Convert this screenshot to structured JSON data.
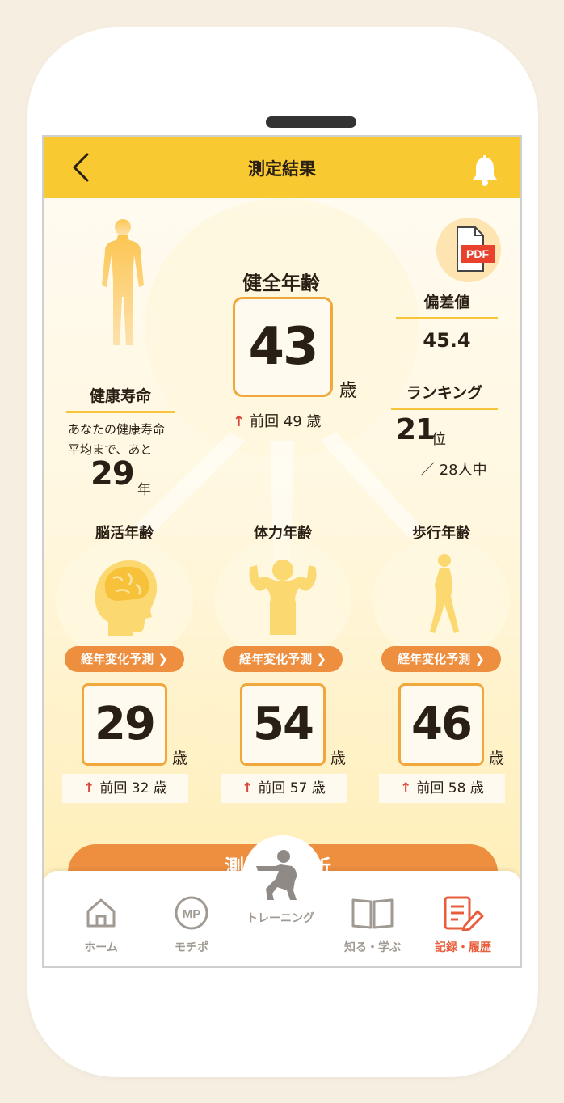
{
  "header": {
    "title": "測定結果"
  },
  "main": {
    "label": "健全年齢",
    "value": "43",
    "unit": "歳",
    "prev_prefix": "前回 ",
    "prev_value": "49",
    "prev_unit": " 歳"
  },
  "lifespan": {
    "title": "健康寿命",
    "line1": "あなたの健康寿命",
    "line2": "平均まで、あと",
    "value": "29",
    "unit": "年"
  },
  "deviation": {
    "title": "偏差値",
    "value": "45.4"
  },
  "ranking": {
    "title": "ランキング",
    "value": "21",
    "unit": "位",
    "total": "／ 28人中"
  },
  "pdf_badge": "PDF",
  "columns": [
    {
      "title": "脳活年齢",
      "pill": "経年変化予測",
      "value": "29",
      "unit": "歳",
      "prev": "前回 32 歳"
    },
    {
      "title": "体力年齢",
      "pill": "経年変化予測",
      "value": "54",
      "unit": "歳",
      "prev": "前回 57 歳"
    },
    {
      "title": "歩行年齢",
      "pill": "経年変化予測",
      "value": "46",
      "unit": "歳",
      "prev": "前回 58 歳"
    }
  ],
  "cta": {
    "label": "測定分析"
  },
  "nav": [
    {
      "label": "ホーム",
      "icon": "home-icon"
    },
    {
      "label": "モチポ",
      "icon": "mp-icon"
    },
    {
      "label": "トレーニング",
      "icon": "training-icon"
    },
    {
      "label": "知る・学ぶ",
      "icon": "book-icon"
    },
    {
      "label": "記録・履歴",
      "icon": "record-icon",
      "active": true
    }
  ],
  "colors": {
    "accent": "#f9c932",
    "orange": "#ee8f40",
    "active_nav": "#e85d3b",
    "up_arrow": "#d9443a"
  }
}
